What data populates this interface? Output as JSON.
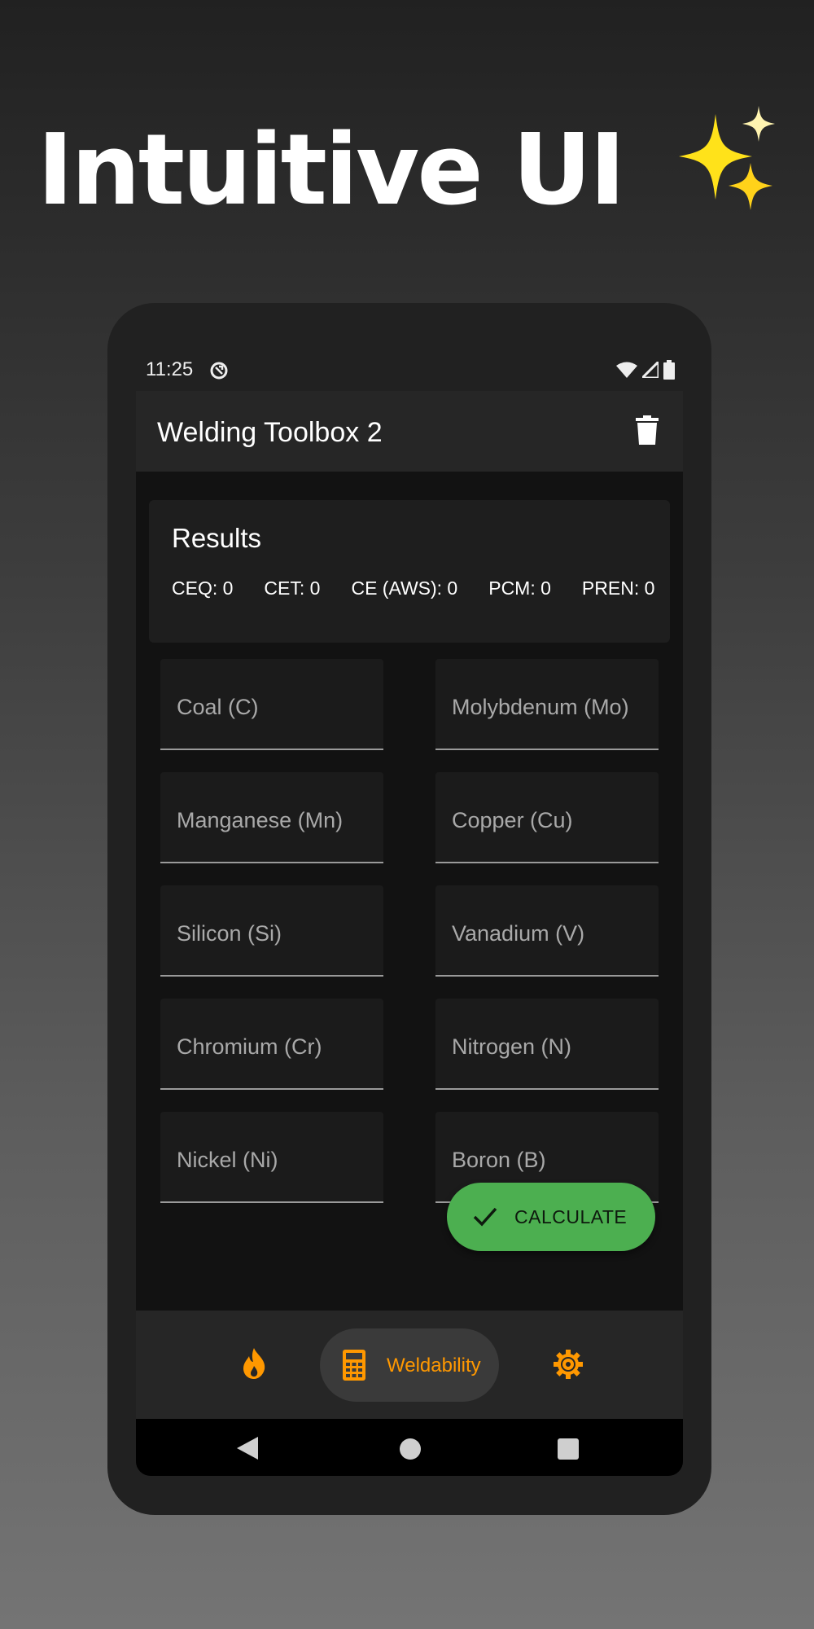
{
  "headline": {
    "text": "Intuitive UI",
    "emoji_icon": "sparkles-icon"
  },
  "status_bar": {
    "time": "11:25"
  },
  "app_bar": {
    "title": "Welding Toolbox 2",
    "action_icon": "trash-icon"
  },
  "results": {
    "title": "Results",
    "metrics": [
      "CEQ: 0",
      "CET: 0",
      "CE (AWS): 0",
      "PCM: 0",
      "PREN: 0"
    ]
  },
  "fields": {
    "left": [
      "Coal (C)",
      "Manganese (Mn)",
      "Silicon (Si)",
      "Chromium (Cr)",
      "Nickel (Ni)"
    ],
    "right": [
      "Molybdenum (Mo)",
      "Copper (Cu)",
      "Vanadium (V)",
      "Nitrogen (N)",
      "Boron (B)"
    ]
  },
  "calculate_button": {
    "label": "CALCULATE"
  },
  "bottom_nav": {
    "items": [
      {
        "icon": "flame-icon",
        "label": ""
      },
      {
        "icon": "calculator-icon",
        "label": "Weldability",
        "selected": true
      },
      {
        "icon": "gear-icon",
        "label": ""
      }
    ]
  },
  "colors": {
    "accent": "#ff9800",
    "button": "#4caf50",
    "background": "#121212"
  }
}
